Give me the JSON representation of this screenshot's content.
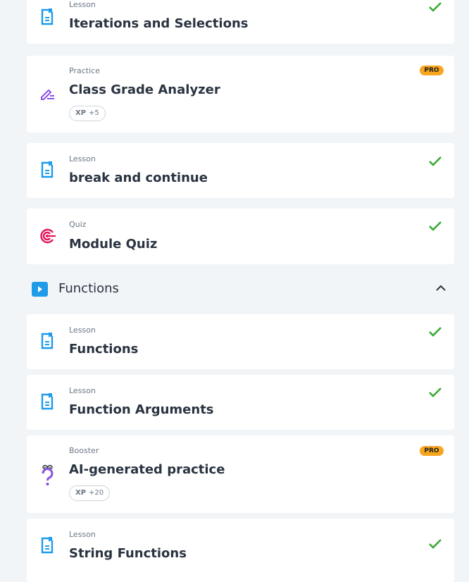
{
  "items": [
    {
      "type": "Lesson",
      "title": "Iterations and Selections",
      "icon": "lesson-icon",
      "status": "done"
    },
    {
      "type": "Practice",
      "title": "Class Grade Analyzer",
      "icon": "pencil-icon",
      "badge": "PRO",
      "xp_label": "XP",
      "xp_value": "+5"
    },
    {
      "type": "Lesson",
      "title": "break and continue",
      "icon": "lesson-icon",
      "status": "done"
    },
    {
      "type": "Quiz",
      "title": "Module Quiz",
      "icon": "target-icon",
      "status": "done"
    },
    {
      "type": "Lesson",
      "title": "Functions",
      "icon": "lesson-icon",
      "status": "done"
    },
    {
      "type": "Lesson",
      "title": "Function Arguments",
      "icon": "lesson-icon",
      "status": "done"
    },
    {
      "type": "Booster",
      "title": "AI-generated practice",
      "icon": "question-icon",
      "badge": "PRO",
      "xp_label": "XP",
      "xp_value": "+20"
    },
    {
      "type": "Lesson",
      "title": "String Functions",
      "icon": "lesson-icon",
      "status": "done"
    }
  ],
  "section": {
    "title": "Functions",
    "expanded": true
  },
  "colors": {
    "accent": "#1e9be9",
    "check": "#3aaa35",
    "pro": "#f8a51c",
    "practice": "#8b52e4",
    "quiz": "#e3135a"
  }
}
